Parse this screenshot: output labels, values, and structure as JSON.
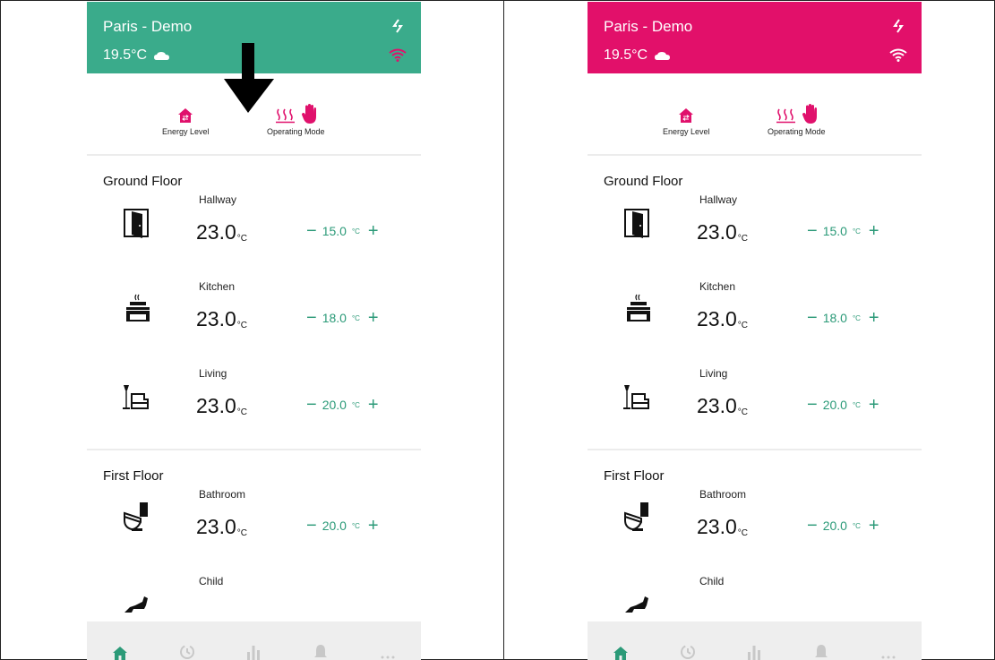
{
  "colors": {
    "header_left": "#3aab8b",
    "header_right": "#e2106a",
    "accent_green": "#2b9a78",
    "accent_pink": "#e0116c",
    "nav_bg": "#eeeeee"
  },
  "panels": [
    {
      "header": {
        "location": "Paris - Demo",
        "outdoor_temp": "19.5°C"
      },
      "modes": [
        {
          "label": "Energy Level"
        },
        {
          "label": "Operating Mode"
        }
      ]
    },
    {
      "header": {
        "location": "Paris - Demo",
        "outdoor_temp": "19.5°C"
      },
      "modes": [
        {
          "label": "Energy Level"
        },
        {
          "label": "Operating Mode"
        }
      ]
    }
  ],
  "floors": [
    {
      "title": "Ground Floor",
      "rooms": [
        {
          "name": "Hallway",
          "temp": "23.0",
          "unit": "°C",
          "setpoint": "15.0",
          "setpoint_unit": "°C",
          "icon": "door-icon"
        },
        {
          "name": "Kitchen",
          "temp": "23.0",
          "unit": "°C",
          "setpoint": "18.0",
          "setpoint_unit": "°C",
          "icon": "stove-icon"
        },
        {
          "name": "Living",
          "temp": "23.0",
          "unit": "°C",
          "setpoint": "20.0",
          "setpoint_unit": "°C",
          "icon": "armchair-lamp-icon"
        }
      ]
    },
    {
      "title": "First Floor",
      "rooms": [
        {
          "name": "Bathroom",
          "temp": "23.0",
          "unit": "°C",
          "setpoint": "20.0",
          "setpoint_unit": "°C",
          "icon": "toilet-icon"
        },
        {
          "name": "Child",
          "icon": "rocking-horse-icon"
        }
      ]
    }
  ],
  "nav": [
    "home-icon",
    "schedule-icon",
    "stats-icon",
    "bell-icon",
    "more-icon"
  ],
  "annotation": "down-arrow-icon"
}
